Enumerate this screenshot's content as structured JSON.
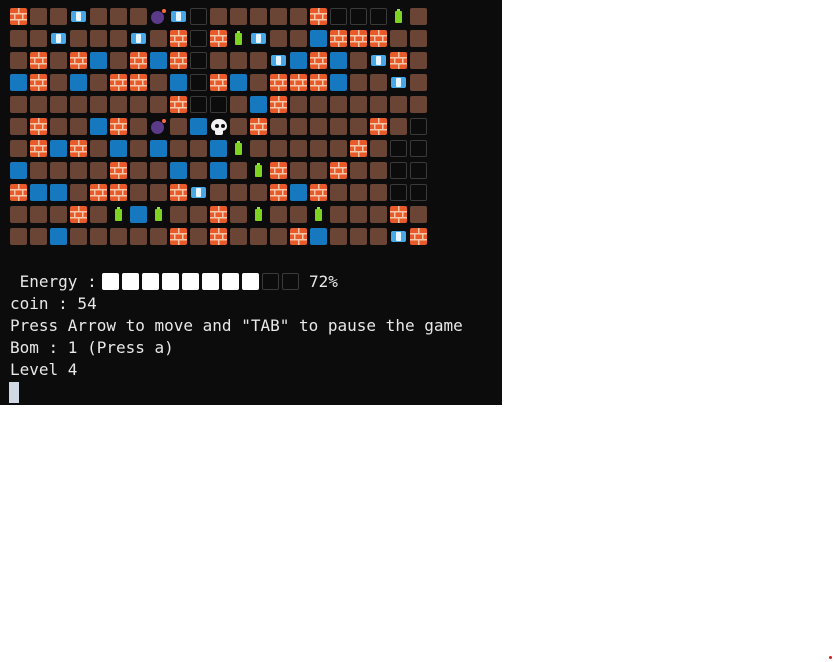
{
  "colors": {
    "background": "#0c0c0c",
    "dirt": "#6a4434",
    "water": "#1679c0",
    "brick": "#e85a2a",
    "battery": "#7ed321",
    "coin": "#46a8e6",
    "bomb": "#5b3a8a",
    "text": "#e8e8e8"
  },
  "legend": {
    "D": "dirt-tile",
    "W": "water-tile",
    "E": "empty-tile",
    "B": "brick-tile",
    "T": "battery-icon",
    "C": "coin-icon",
    "X": "bomb-icon",
    "S": "skull-icon"
  },
  "grid": [
    "BDDCDDDXCEDDDDDBEEETD",
    "DDCDDDCDBEBTCDDWBBBDD",
    "DBDBWDBWBEDDDCWBWDCBD",
    "WBDWDBBDWEBWDBBBWDDCD",
    "DDDDDDDDBEEDWBDDDDDDD",
    "DBDDWBDXDWSDBDDDDDBDE",
    "DBWBDWDWDDWTDDDDDBDEE",
    "WDDDDBDDWDWDTBDDBDDEE",
    "BWWDBBDDBCDDDBWBDDDEE",
    "DDDBDTWTDDBDTDDTDDDBD",
    "DDWDDDDDBDBDDDBWDDDCB"
  ],
  "hud": {
    "energy_label": " Energy :",
    "energy_percent": "72%",
    "energy_level": 0.72,
    "energy_segments_filled": 8,
    "energy_segments_total": 10,
    "coin_line": "coin : 54",
    "instructions": "Press Arrow to move and \"TAB\" to pause the game",
    "bomb_line": "Bom : 1 (Press a)",
    "level_line": "Level 4"
  }
}
